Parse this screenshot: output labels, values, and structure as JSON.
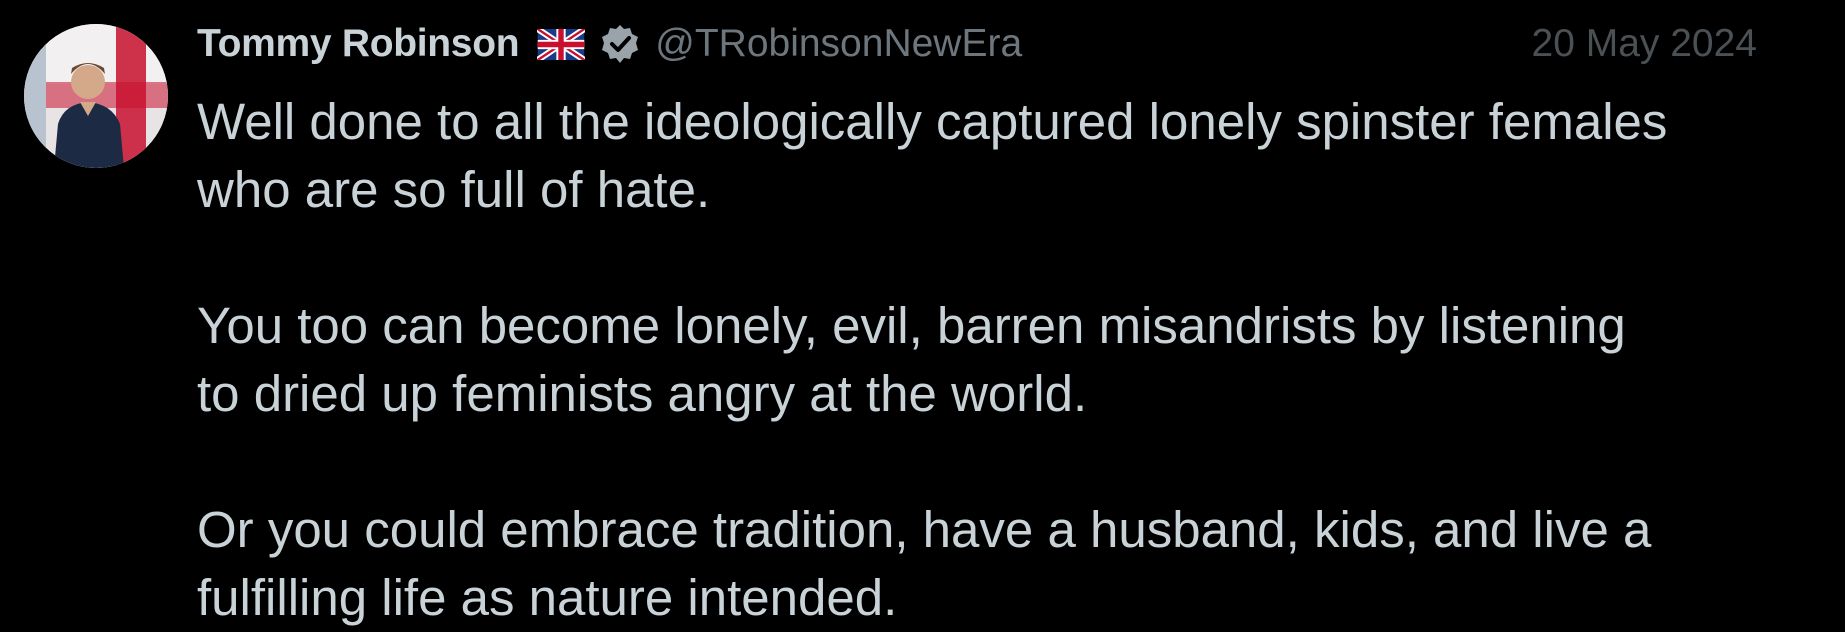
{
  "tweet": {
    "author": {
      "display_name": "Tommy Robinson",
      "flag_emoji": "uk-flag-icon",
      "verified": true,
      "handle": "@TRobinsonNewEra"
    },
    "date": "20 May 2024",
    "paragraphs": [
      "Well done to all the ideologically captured lonely spinster females\nwho are so full of hate.",
      "You too can become lonely, evil, barren misandrists by listening\nto dried up feminists angry at the world.",
      "Or you could embrace tradition, have a husband, kids, and live a\nfulfilling life as nature intended."
    ]
  },
  "colors": {
    "background": "#000000",
    "text": "#c8d2d7",
    "handle": "#6e767d",
    "date": "#4a5054",
    "verified_badge": "#9aa3a9"
  }
}
